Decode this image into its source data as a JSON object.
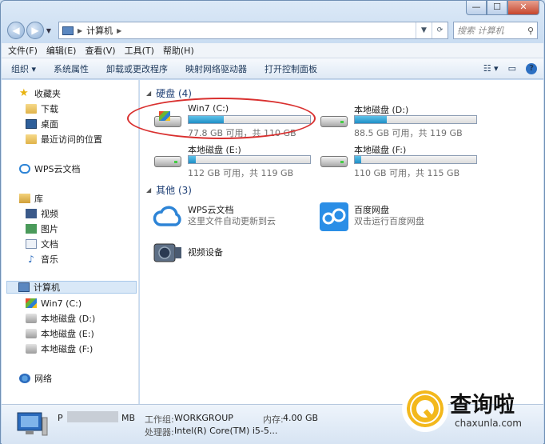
{
  "window": {
    "caption": {
      "minimize": "—",
      "maximize": "☐",
      "close": "✕"
    }
  },
  "nav": {
    "back_label": "◀",
    "forward_label": "▶",
    "address_path": [
      "计算机"
    ],
    "search_placeholder": "搜索 计算机"
  },
  "menubar": [
    "文件(F)",
    "编辑(E)",
    "查看(V)",
    "工具(T)",
    "帮助(H)"
  ],
  "commands": {
    "organize": "组织 ▾",
    "items": [
      "系统属性",
      "卸载或更改程序",
      "映射网络驱动器",
      "打开控制面板"
    ]
  },
  "sidebar": {
    "favorites": {
      "label": "收藏夹",
      "items": [
        "下载",
        "桌面",
        "最近访问的位置"
      ]
    },
    "wps": "WPS云文档",
    "library": {
      "label": "库",
      "items": [
        "视频",
        "图片",
        "文档",
        "音乐"
      ]
    },
    "computer": {
      "label": "计算机",
      "items": [
        "Win7 (C:)",
        "本地磁盘 (D:)",
        "本地磁盘 (E:)",
        "本地磁盘 (F:)"
      ]
    },
    "network": "网络"
  },
  "content": {
    "drives_header": "硬盘 (4)",
    "drives": [
      {
        "name": "Win7 (C:)",
        "free": "77.8 GB 可用，共 110 GB",
        "used_fraction": 0.29
      },
      {
        "name": "本地磁盘 (D:)",
        "free": "88.5 GB 可用，共 119 GB",
        "used_fraction": 0.26
      },
      {
        "name": "本地磁盘 (E:)",
        "free": "112 GB 可用，共 119 GB",
        "used_fraction": 0.06
      },
      {
        "name": "本地磁盘 (F:)",
        "free": "110 GB 可用，共 115 GB",
        "used_fraction": 0.05
      }
    ],
    "others_header": "其他 (3)",
    "others": [
      {
        "name": "WPS云文档",
        "desc": "这里文件自动更新到云"
      },
      {
        "name": "百度网盘",
        "desc": "双击运行百度网盘"
      },
      {
        "name": "视频设备",
        "desc": ""
      }
    ]
  },
  "details": {
    "pc_name_prefix": "P",
    "pc_name_suffix": "MB",
    "workgroup_label": "工作组:",
    "workgroup_value": "WORKGROUP",
    "memory_label": "内存:",
    "memory_value": "4.00 GB",
    "cpu_label": "处理器:",
    "cpu_value": "Intel(R) Core(TM) i5-5..."
  },
  "watermark": {
    "title": "查询啦",
    "url": "chaxunla.com"
  },
  "colors": {
    "accent": "#1f8fc6",
    "ring": "#d9302f",
    "watermark": "#f3b81c"
  }
}
